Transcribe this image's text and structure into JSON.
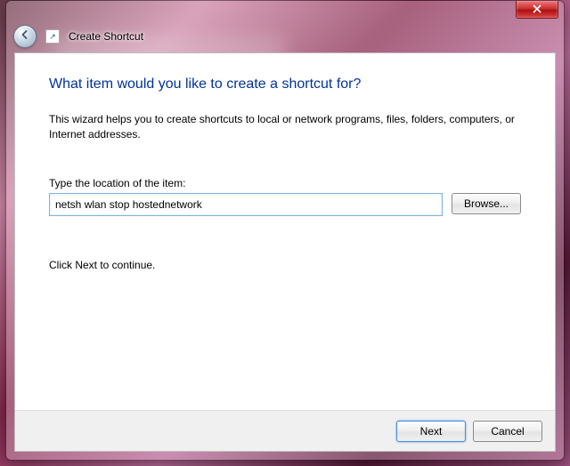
{
  "titlebar": {
    "window_title": "Create Shortcut"
  },
  "wizard": {
    "heading": "What item would you like to create a shortcut for?",
    "description": "This wizard helps you to create shortcuts to local or network programs, files, folders, computers, or Internet addresses.",
    "field_label": "Type the location of the item:",
    "location_value": "netsh wlan stop hostednetwork",
    "browse_label": "Browse...",
    "continue_text": "Click Next to continue."
  },
  "footer": {
    "next_label": "Next",
    "cancel_label": "Cancel"
  },
  "icons": {
    "back": "back-arrow",
    "close": "close-x",
    "shortcut": "shortcut-overlay"
  }
}
